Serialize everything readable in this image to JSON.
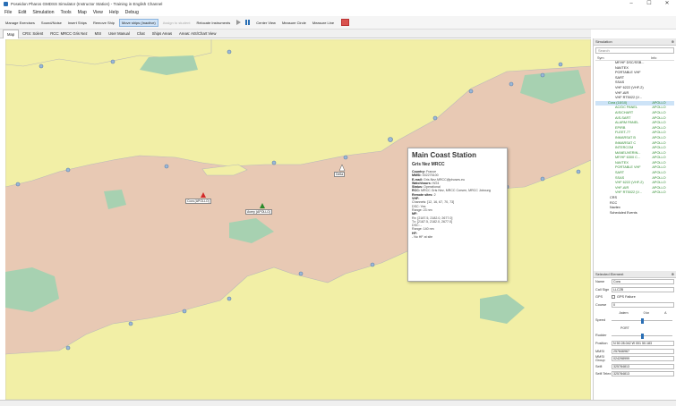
{
  "window": {
    "title": "Poseidon Pharos GMDSS Simulator (Instructor Station) - Training in English Channel"
  },
  "menu": [
    "File",
    "Edit",
    "Simulation",
    "Tools",
    "Map",
    "View",
    "Help",
    "Debug"
  ],
  "toolbar": {
    "manage_exercises": "Manage Exercises",
    "sounds_noise": "Sound/Noise",
    "insert_ships": "Insert Ships",
    "remove_ship": "Remove Ship",
    "move_ships": "Move ships (Inactive)",
    "assign_student": "Assign to student",
    "relocate_instruments": "Relocate Instruments",
    "center_view": "Center View",
    "measure_circle": "Measure Circle",
    "measure_line": "Measure Line"
  },
  "tabs": [
    "Map",
    "CRS: Solent",
    "RCC: MRCC Gris Nez",
    "MSI",
    "User Manual",
    "Chat",
    "Ships Areas",
    "Areas: AIS/Chart View"
  ],
  "map_labels": {
    "ship1": "Cora (APOLLO)",
    "ship2": "Avery (APOLLO)",
    "ship3": "Delta"
  },
  "popup": {
    "title": "Main Coast Station",
    "subtitle": "Gris Nez MRCC",
    "lines": [
      {
        "k": "Country:",
        "v": " France"
      },
      {
        "k": "MMSI:",
        "v": " 002275100"
      },
      {
        "k": "E-mail:",
        "v": " Gris.Nez.MRCC@phoses.eu"
      },
      {
        "k": "Watchhours:",
        "v": " H/24"
      },
      {
        "k": "Status:",
        "v": " Operational"
      },
      {
        "k": "RCC:",
        "v": " MRCC Gris Nez, MRCC Corsen, MRCC Jobourg"
      },
      {
        "k": "Remote sites:",
        "v": " 2"
      },
      {
        "k": "VHF:",
        "v": ""
      },
      {
        "k": "",
        "v": "Channels: [12, 16, 67, 70, 73]"
      },
      {
        "k": "",
        "v": "DSC: Yes"
      },
      {
        "k": "",
        "v": "Range: 23 nm"
      },
      {
        "k": "MF:",
        "v": ""
      },
      {
        "k": "",
        "v": "Rx: [2187.5, 2182.0, 2677.0]"
      },
      {
        "k": "",
        "v": "Tx: [2187.5, 2182.0, 2677.0]"
      },
      {
        "k": "",
        "v": "DSC: -"
      },
      {
        "k": "",
        "v": "Range: 140 nm"
      },
      {
        "k": "HF:",
        "v": ""
      },
      {
        "k": "",
        "v": "- No HF at site"
      }
    ]
  },
  "simulation_panel": {
    "title": "Simulation",
    "search_placeholder": "Search",
    "col_name": "Sym",
    "col_info": "Info",
    "rows": [
      {
        "n": "MF/HF DSC/SSB...",
        "i": "",
        "g": false,
        "sel": false,
        "ind": 8
      },
      {
        "n": "NAVTEX",
        "i": "",
        "g": false,
        "sel": false,
        "ind": 8
      },
      {
        "n": "PORTABLE VHF",
        "i": "",
        "g": false,
        "sel": false,
        "ind": 8
      },
      {
        "n": "SART",
        "i": "",
        "g": false,
        "sel": false,
        "ind": 8
      },
      {
        "n": "SSAS",
        "i": "",
        "g": false,
        "sel": false,
        "ind": 8
      },
      {
        "n": "VHF 6222 (VHF-2)",
        "i": "",
        "g": false,
        "sel": false,
        "ind": 8
      },
      {
        "n": "VHF-AIR",
        "i": "",
        "g": false,
        "sel": false,
        "ind": 8
      },
      {
        "n": "VHF RT5022 (V...",
        "i": "",
        "g": false,
        "sel": false,
        "ind": 8
      },
      {
        "n": "Cora (18/10)",
        "i": "APOLLO",
        "g": true,
        "sel": true,
        "ind": 0
      },
      {
        "n": "AC/DC PANEL",
        "i": "APOLLO",
        "g": true,
        "sel": false,
        "ind": 8
      },
      {
        "n": "AIS/CHART",
        "i": "APOLLO",
        "g": true,
        "sel": false,
        "ind": 8
      },
      {
        "n": "AIS-SART",
        "i": "APOLLO",
        "g": true,
        "sel": false,
        "ind": 8
      },
      {
        "n": "ALARM PANEL",
        "i": "APOLLO",
        "g": true,
        "sel": false,
        "ind": 8
      },
      {
        "n": "EPIRB",
        "i": "APOLLO",
        "g": true,
        "sel": false,
        "ind": 8
      },
      {
        "n": "FLEET-77",
        "i": "APOLLO",
        "g": true,
        "sel": false,
        "ind": 8
      },
      {
        "n": "INMARSAT B",
        "i": "APOLLO",
        "g": true,
        "sel": false,
        "ind": 8
      },
      {
        "n": "INMARSAT C",
        "i": "APOLLO",
        "g": true,
        "sel": false,
        "ind": 8
      },
      {
        "n": "INTERCOM",
        "i": "APOLLO",
        "g": true,
        "sel": false,
        "ind": 8
      },
      {
        "n": "MANEUVERIN...",
        "i": "APOLLO",
        "g": true,
        "sel": false,
        "ind": 8
      },
      {
        "n": "MF/HF 6300 C...",
        "i": "APOLLO",
        "g": true,
        "sel": false,
        "ind": 8
      },
      {
        "n": "NAVTEX",
        "i": "APOLLO",
        "g": true,
        "sel": false,
        "ind": 8
      },
      {
        "n": "PORTABLE VHF",
        "i": "APOLLO",
        "g": true,
        "sel": false,
        "ind": 8
      },
      {
        "n": "SART",
        "i": "APOLLO",
        "g": true,
        "sel": false,
        "ind": 8
      },
      {
        "n": "SSAS",
        "i": "APOLLO",
        "g": true,
        "sel": false,
        "ind": 8
      },
      {
        "n": "VHF 6222 (VHF-2)",
        "i": "APOLLO",
        "g": true,
        "sel": false,
        "ind": 8
      },
      {
        "n": "VHF-AIR",
        "i": "APOLLO",
        "g": true,
        "sel": false,
        "ind": 8
      },
      {
        "n": "VHF RT5022 (V...",
        "i": "APOLLO",
        "g": true,
        "sel": false,
        "ind": 8
      },
      {
        "n": "CRS",
        "i": "",
        "g": false,
        "sel": false,
        "ind": 2
      },
      {
        "n": "RCC",
        "i": "",
        "g": false,
        "sel": false,
        "ind": 2
      },
      {
        "n": "Navtex",
        "i": "",
        "g": false,
        "sel": false,
        "ind": 2
      },
      {
        "n": "Scheduled Events",
        "i": "",
        "g": false,
        "sel": false,
        "ind": 2
      }
    ]
  },
  "selected_panel": {
    "title": "Selected Element",
    "name_label": "Name",
    "name_value": "Cora",
    "callsign_label": "Call Sign",
    "callsign_value": "LLC2B",
    "gps_label": "GPS",
    "gps_value": "GPS Failure",
    "course_label": "Course",
    "course_value": "0",
    "astern": "Astern",
    "zero_kn": "0 kn",
    "ahead": "A",
    "speed_label": "Speed",
    "speed_fraction": 0.5,
    "port": "PORT",
    "rudder_label": "Rudder",
    "rudder_fraction": 0.5,
    "position_label": "Position",
    "position_value": "N 50 28.042 W 001 50.183",
    "mmsi_label": "MMSI",
    "mmsi_value": "257846967",
    "mmsi_group_label": "MMSI Group",
    "mmsi_group_value": "024298999",
    "selfi_label": "Selfi",
    "selfi_value": "325784813",
    "selfi_telex_label": "Selfi Telex",
    "selfi_telex_value": "325784813"
  },
  "colors": {
    "land": "#f2efa6",
    "sea": "#e8c9b4",
    "shallow": "#a7d1b1",
    "station": "#9bb8d8"
  }
}
